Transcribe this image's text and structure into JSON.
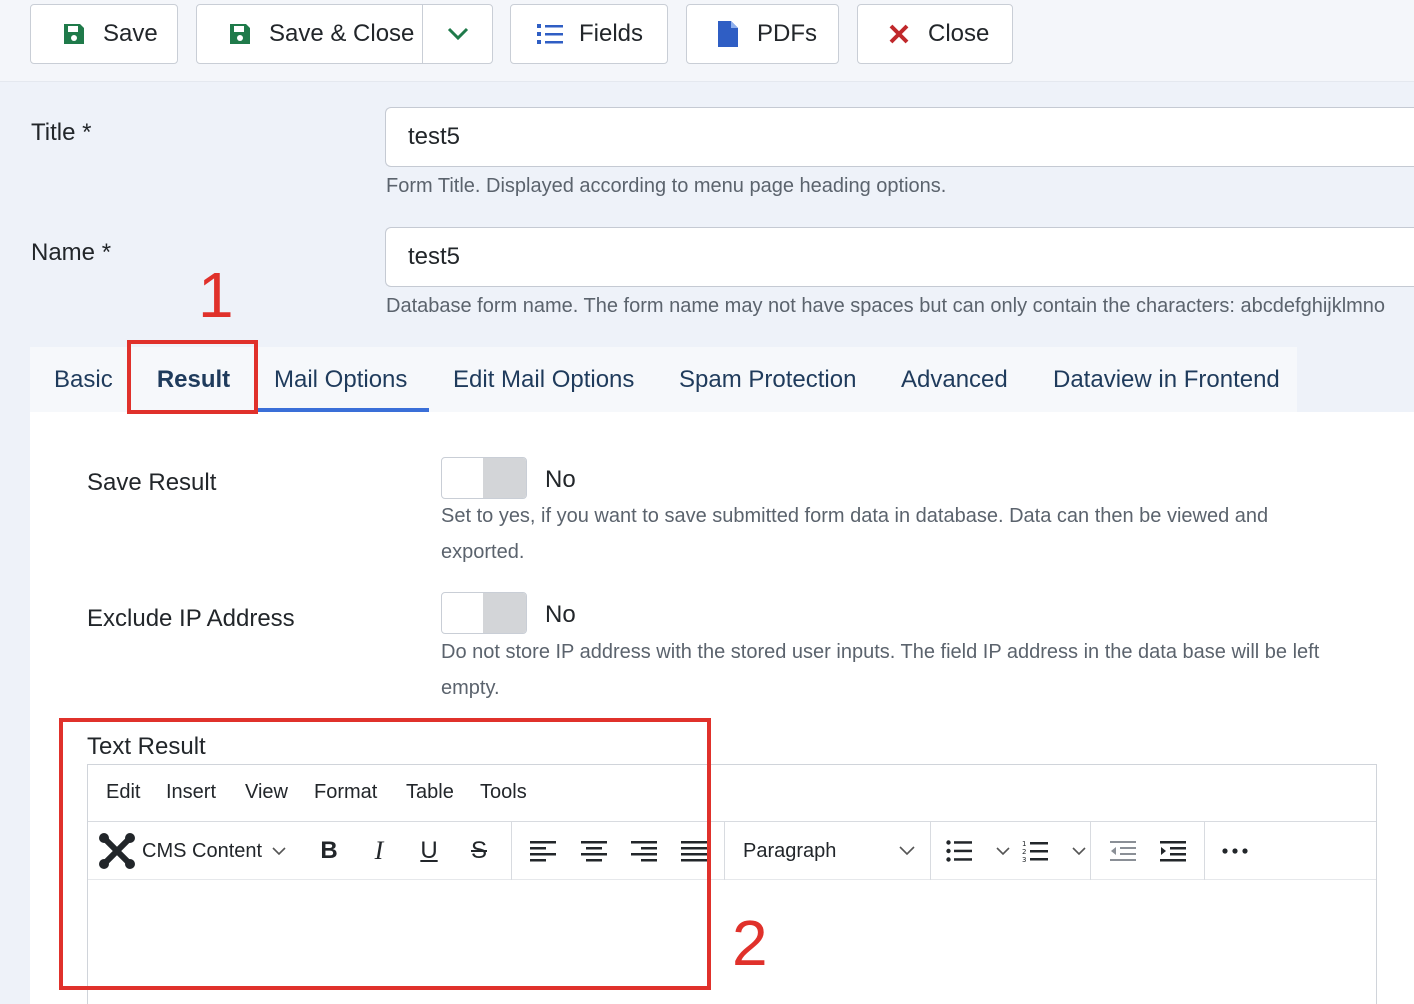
{
  "toolbar": {
    "save": "Save",
    "save_close": "Save & Close",
    "fields": "Fields",
    "pdfs": "PDFs",
    "close": "Close"
  },
  "form": {
    "title_label": "Title *",
    "title_value": "test5",
    "title_hint": "Form Title. Displayed according to menu page heading options.",
    "name_label": "Name *",
    "name_value": "test5",
    "name_hint": "Database form name. The form name may not have spaces but can only contain the characters: abcdefghijklmno"
  },
  "annotations": {
    "one": "1",
    "two": "2"
  },
  "tabs": [
    {
      "label": "Basic"
    },
    {
      "label": "Result"
    },
    {
      "label": "Mail Options"
    },
    {
      "label": "Edit Mail Options"
    },
    {
      "label": "Spam Protection"
    },
    {
      "label": "Advanced"
    },
    {
      "label": "Dataview in Frontend"
    }
  ],
  "result": {
    "save_result_label": "Save Result",
    "save_result_value": "No",
    "save_result_desc_1": "Set to yes, if you want to save submitted form data in database. Data can then be viewed and",
    "save_result_desc_2": "exported.",
    "exclude_ip_label": "Exclude IP Address",
    "exclude_ip_value": "No",
    "exclude_ip_desc_1": "Do not store IP address with the stored user inputs. The field IP address in the data base will be left",
    "exclude_ip_desc_2": "empty.",
    "text_result_label": "Text Result"
  },
  "editor": {
    "menu": [
      "Edit",
      "Insert",
      "View",
      "Format",
      "Table",
      "Tools"
    ],
    "cms_content": "CMS Content",
    "block_format": "Paragraph"
  },
  "colors": {
    "accent_red": "#e0312b",
    "tab_underline": "#3a6fd8",
    "save_icon": "#1f7a4a",
    "close_icon": "#c0282b",
    "doc_icon": "#2f5ec4"
  }
}
